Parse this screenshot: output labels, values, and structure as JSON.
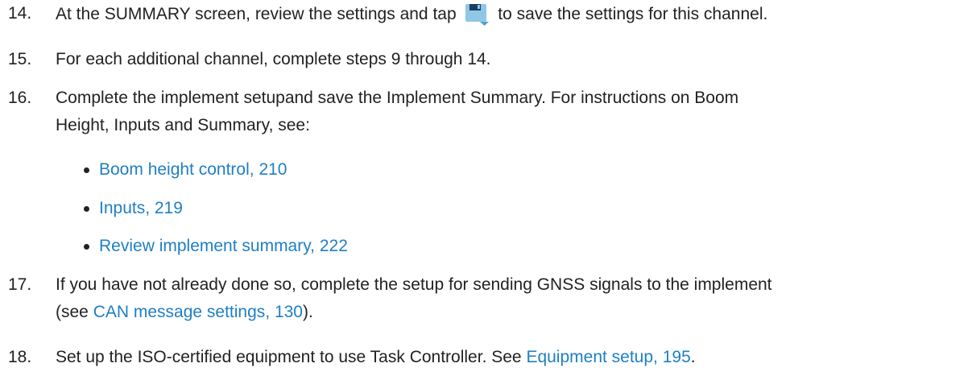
{
  "steps": [
    {
      "num": "14.",
      "before": "At the SUMMARY screen, review the settings and tap ",
      "after": " to save the settings for this channel.",
      "icon": "save-icon"
    },
    {
      "num": "15.",
      "text": "For each additional channel, complete steps 9 through 14."
    },
    {
      "num": "16.",
      "line1": "Complete the implement setupand save the Implement Summary. For instructions on Boom",
      "line2": "Height, Inputs and Summary, see:",
      "links": [
        "Boom height control, 210",
        "Inputs, 219",
        "Review implement summary, 222"
      ]
    },
    {
      "num": "17.",
      "line1": "If you have not already done so, complete the setup for sending GNSS signals to the implement",
      "line2_before": "(see ",
      "line2_link": "CAN message settings, 130",
      "line2_after": ")."
    },
    {
      "num": "18.",
      "before": "Set up the ISO-certified equipment to use Task Controller. See ",
      "link": "Equipment setup, 195",
      "after": "."
    }
  ],
  "colors": {
    "text": "#222222",
    "link": "#1f7fc4"
  }
}
